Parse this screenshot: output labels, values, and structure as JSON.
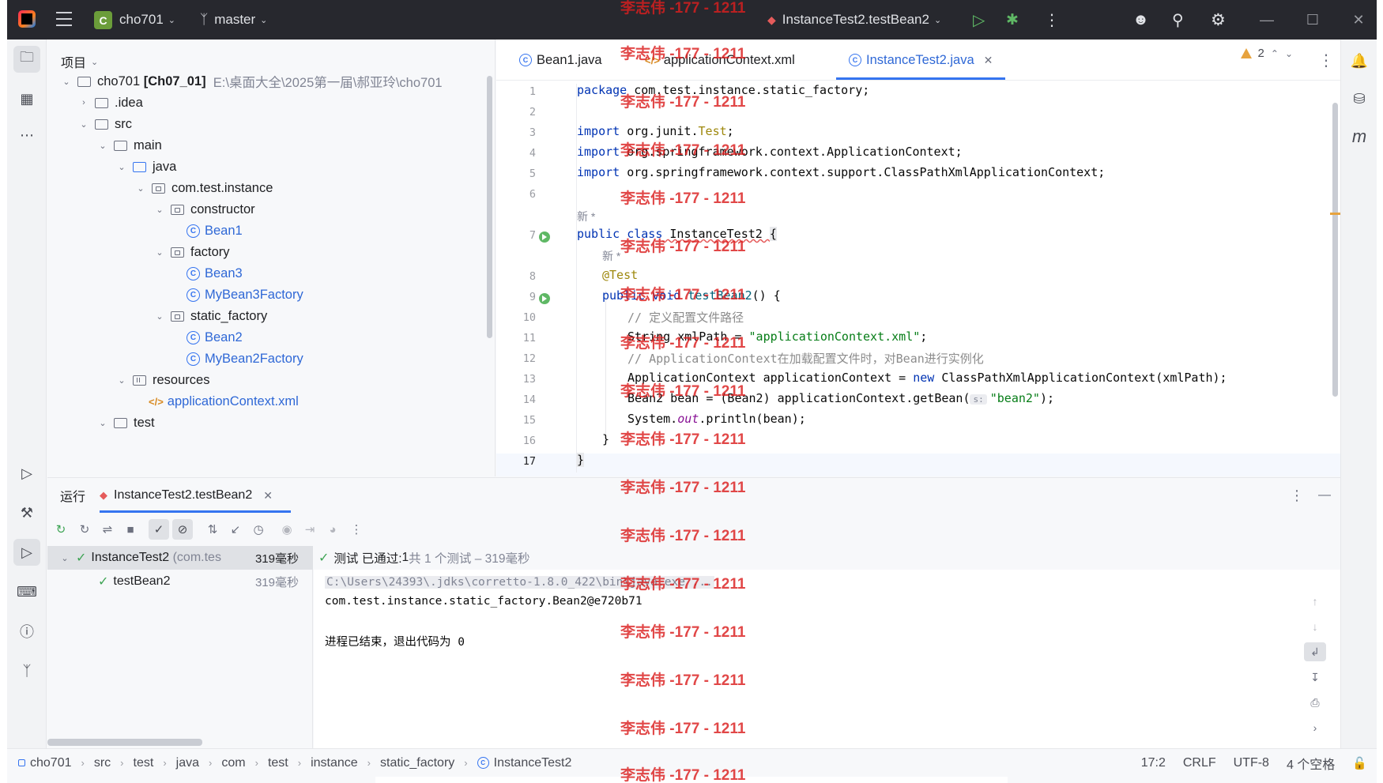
{
  "titlebar": {
    "project_letter": "C",
    "project": "cho701",
    "branch": "master",
    "run_config": "InstanceTest2.testBean2"
  },
  "project_panel": {
    "title": "项目",
    "tree": [
      {
        "label": "cho701",
        "suffix": "[Ch07_01]",
        "path": "E:\\桌面大全\\2025第一届\\郝亚玲\\cho701"
      },
      {
        "label": ".idea"
      },
      {
        "label": "src"
      },
      {
        "label": "main"
      },
      {
        "label": "java"
      },
      {
        "label": "com.test.instance"
      },
      {
        "label": "constructor"
      },
      {
        "label": "Bean1"
      },
      {
        "label": "factory"
      },
      {
        "label": "Bean3"
      },
      {
        "label": "MyBean3Factory"
      },
      {
        "label": "static_factory"
      },
      {
        "label": "Bean2"
      },
      {
        "label": "MyBean2Factory"
      },
      {
        "label": "resources"
      },
      {
        "label": "applicationContext.xml"
      },
      {
        "label": "test"
      }
    ]
  },
  "editor": {
    "tabs": [
      {
        "label": "Bean1.java"
      },
      {
        "label": "applicationContext.xml"
      },
      {
        "label": "InstanceTest2.java"
      }
    ],
    "warnings": "2",
    "inlay_new": "新 *",
    "line_numbers": [
      "1",
      "2",
      "3",
      "4",
      "5",
      "6",
      "7",
      "8",
      "9",
      "10",
      "11",
      "12",
      "13",
      "14",
      "15",
      "16",
      "17"
    ],
    "code": {
      "l1a": "package",
      "l1b": " com.test.instance.static_factory;",
      "l3a": "import",
      "l3b": " org.junit.",
      "l3c": "Test",
      "l3d": ";",
      "l4a": "import",
      "l4b": " org.springframework.context.ApplicationContext;",
      "l5a": "import",
      "l5b": " org.springframework.context.support.ClassPathXmlApplicationContext;",
      "l7a": "public class",
      "l7b": " InstanceTest2 ",
      "l7c": "{",
      "l8": "@Test",
      "l9a": "public void",
      "l9b": " testBean2",
      "l9c": "() {",
      "l10": "// 定义配置文件路径",
      "l11a": "String xmlPath = ",
      "l11b": "\"applicationContext.xml\"",
      "l11c": ";",
      "l12": "// ApplicationContext在加载配置文件时，对Bean进行实例化",
      "l13a": "ApplicationContext applicationContext = ",
      "l13b": "new",
      "l13c": " ClassPathXmlApplicationContext(xmlPath);",
      "l14a": "Bean2 bean = (Bean2) applicationContext.getBean(",
      "l14hint": "s:",
      "l14b": "\"bean2\"",
      "l14c": ");",
      "l15a": "System.",
      "l15b": "out",
      "l15c": ".println(bean);",
      "l16": "}",
      "l17": "}"
    }
  },
  "run_panel": {
    "title": "运行",
    "tab": "InstanceTest2.testBean2",
    "tests": [
      {
        "name": "InstanceTest2",
        "detail": "(com.tes",
        "time": "319毫秒"
      },
      {
        "name": "testBean2",
        "time": "319毫秒"
      }
    ],
    "status_prefix": "测试 已通过: ",
    "status_count": "1",
    "status_suffix": "共 1 个测试 – 319毫秒",
    "console": [
      "C:\\Users\\24393\\.jdks\\corretto-1.8.0_422\\bin\\java.exe ...",
      "com.test.instance.static_factory.Bean2@e720b71",
      "",
      "进程已结束，退出代码为 0"
    ]
  },
  "statusbar": {
    "breadcrumbs": [
      "cho701",
      "src",
      "test",
      "java",
      "com",
      "test",
      "instance",
      "static_factory",
      "InstanceTest2"
    ],
    "position": "17:2",
    "line_sep": "CRLF",
    "encoding": "UTF-8",
    "indent": "4 个空格"
  },
  "watermark": "李志伟 -177 - 1211",
  "colors": {
    "accent": "#3574f0",
    "titlebar": "#27282e",
    "pass": "#3ea454",
    "watermark": "#da1e1e"
  }
}
